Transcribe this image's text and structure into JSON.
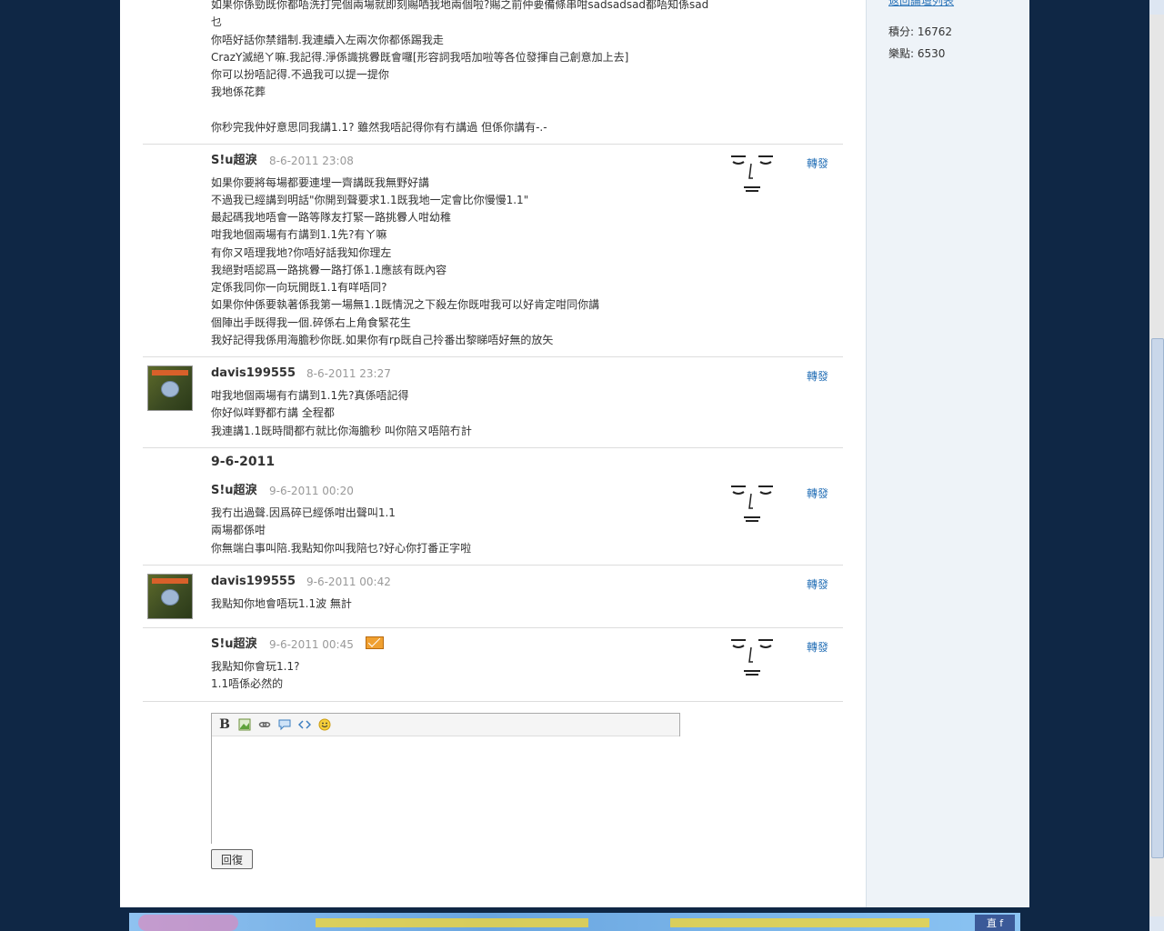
{
  "sidebar": {
    "prev_link": "返回論壇列表",
    "stats": [
      {
        "label": "積分: 16762"
      },
      {
        "label": "樂點: 6530"
      }
    ]
  },
  "top_fragment": {
    "lines": [
      "如果你係勁既你都唔洗打完個兩場就即刻賜哂我地兩個啦?賜之前仲要備條串咁sadsadsad都唔知係sad",
      "乜",
      "你唔好話你禁錯制.我連續入左兩次你都係踢我走",
      "CrazY滅絕ㄚ嘛.我記得.淨係識挑釁既會囉[形容詞我唔加啦等各位發揮自己創意加上去]",
      "你可以扮唔記得.不過我可以提一提你",
      "我地係花葬",
      "",
      "你秒完我仲好意思同我講1.1? 雖然我唔記得你有冇講過 但係你講有-.-"
    ]
  },
  "posts": [
    {
      "author": "S!u超淚",
      "time": "8-6-2011 23:08",
      "forward": "轉發",
      "lines": [
        "如果你要將每場都要連埋一齊講既我無野好講",
        "不過我已經講到明話\"你開到聲要求1.1既我地一定會比你慢慢1.1\"",
        "最起碼我地唔會一路等隊友打緊一路挑釁人咁幼稚",
        "咁我地個兩場有冇講到1.1先?有ㄚ嘛",
        "有你ㄡ唔理我地?你唔好話我知你理左",
        "我絕對唔認爲一路挑釁一路打係1.1應該有既內容",
        "定係我同你一向玩開既1.1有咩唔同?",
        "如果你仲係要執著係我第一場無1.1既情況之下殺左你既咁我可以好肯定咁同你講",
        "個陣出手既得我一個.碎係右上角食緊花生",
        "我好記得我係用海膽秒你既.如果你有rp既自己拎番出黎睇唔好無的放矢"
      ]
    },
    {
      "author": "davis199555",
      "time": "8-6-2011 23:27",
      "forward": "轉發",
      "lines": [
        "咁我地個兩場有冇講到1.1先?真係唔記得",
        "你好似咩野都冇講 全程都",
        "我連講1.1既時間都冇就比你海膽秒 叫你陪ㄡ唔陪冇計"
      ]
    },
    {
      "date_header": "9-6-2011",
      "author": "S!u超淚",
      "time": "9-6-2011 00:20",
      "forward": "轉發",
      "lines": [
        "我冇出過聲.因爲碎已經係咁出聲叫1.1",
        "兩場都係咁",
        "你無端白事叫陪.我點知你叫我陪乜?好心你打番正字啦"
      ]
    },
    {
      "author": "davis199555",
      "time": "9-6-2011 00:42",
      "forward": "轉發",
      "lines": [
        "我點知你地會唔玩1.1波 無計"
      ]
    },
    {
      "author": "S!u超淚",
      "time": "9-6-2011 00:45",
      "forward": "轉發",
      "lines": [
        "我點知你會玩1.1?",
        "1.1唔係必然的"
      ]
    }
  ],
  "editor": {
    "toolbar": [
      "B",
      "image",
      "link",
      "quote",
      "code",
      "smiley"
    ],
    "reply_label": "回復"
  },
  "banner": {
    "fb_label": "直 f"
  },
  "icons": {
    "mail": "mail-icon",
    "face": "avatar-face-sketch"
  }
}
